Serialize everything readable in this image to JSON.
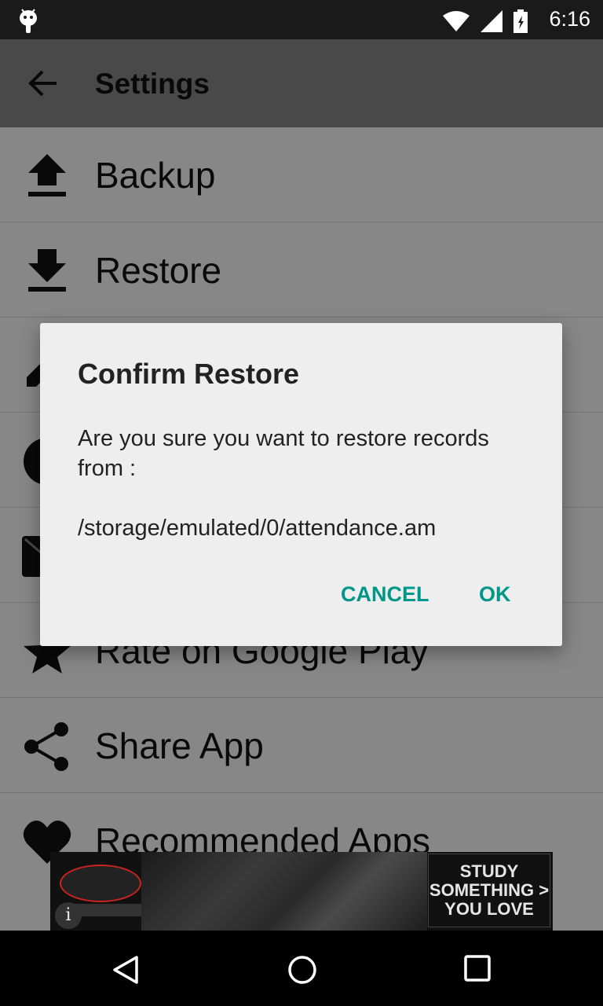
{
  "status_bar": {
    "time": "6:16",
    "icons": [
      "android-icon",
      "wifi-icon",
      "cell-signal-icon",
      "battery-icon"
    ]
  },
  "app_bar": {
    "title": "Settings"
  },
  "menu": {
    "items": [
      {
        "label": "Backup",
        "icon": "upload-icon"
      },
      {
        "label": "Restore",
        "icon": "download-icon"
      },
      {
        "label": "",
        "icon": "edit-icon"
      },
      {
        "label": "",
        "icon": "clock-icon"
      },
      {
        "label": "",
        "icon": "email-icon"
      },
      {
        "label": "Rate on Google Play",
        "icon": "star-icon"
      },
      {
        "label": "Share App",
        "icon": "share-icon"
      },
      {
        "label": "Recommended Apps",
        "icon": "heart-icon"
      }
    ]
  },
  "dialog": {
    "title": "Confirm Restore",
    "message": "Are you sure you want to restore records from :",
    "path": "/storage/emulated/0/attendance.am",
    "cancel_label": "CANCEL",
    "ok_label": "OK"
  },
  "ad": {
    "cta_line1": "STUDY",
    "cta_line2": "SOMETHING >",
    "cta_line3": "YOU LOVE",
    "info_glyph": "i"
  },
  "colors": {
    "accent": "#009688",
    "status_bar": "#1a1a1a",
    "dialog_bg": "#eeeeee"
  }
}
